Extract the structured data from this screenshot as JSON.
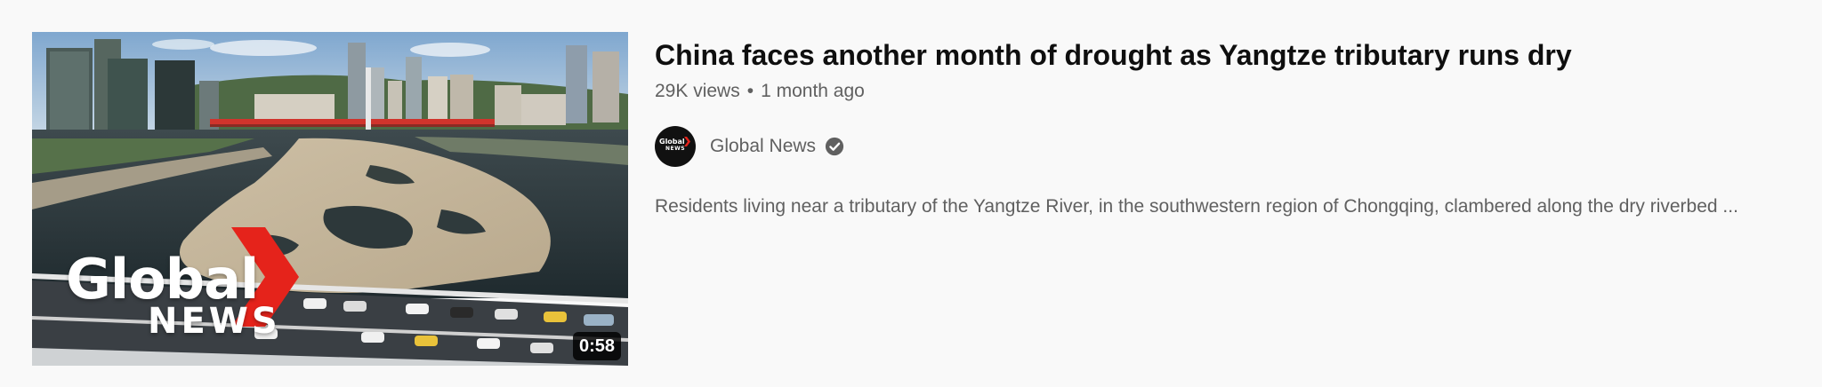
{
  "video": {
    "duration": "0:58",
    "thumbnail_logo": {
      "word_top": "Global",
      "word_bottom": "NEWS"
    },
    "title": "China faces another month of drought as Yangtze tributary runs dry",
    "views": "29K views",
    "separator": "•",
    "age": "1 month ago",
    "description": "Residents living near a tributary of the Yangtze River, in the southwestern region of Chongqing, clambered along the dry riverbed ..."
  },
  "channel": {
    "name": "Global News",
    "avatar_word_top": "Global",
    "avatar_word_bottom": "NEWS",
    "verified_icon": "check-circle-icon"
  },
  "colors": {
    "brand_red": "#e5231b",
    "text_primary": "#0f0f0f",
    "text_secondary": "#606060",
    "background": "#f9f9f9"
  }
}
